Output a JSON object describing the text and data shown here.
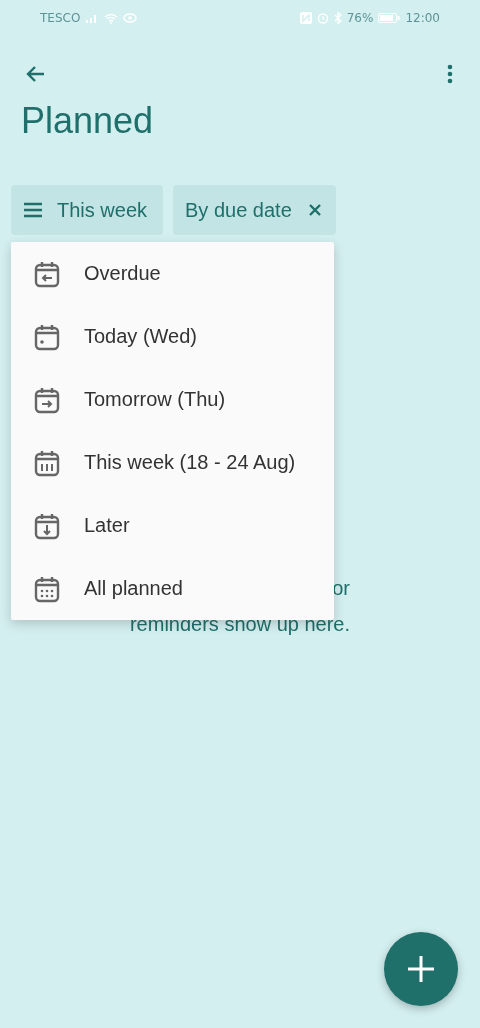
{
  "status_bar": {
    "carrier": "TESCO",
    "battery": "76%",
    "time": "12:00"
  },
  "title": "Planned",
  "chips": [
    {
      "label": "This week",
      "kind": "menu"
    },
    {
      "label": "By due date",
      "kind": "removable"
    }
  ],
  "menu": [
    {
      "label": "Overdue"
    },
    {
      "label": "Today (Wed)"
    },
    {
      "label": "Tomorrow (Thu)"
    },
    {
      "label": "This week (18 - 24 Aug)"
    },
    {
      "label": "Later"
    },
    {
      "label": "All planned"
    }
  ],
  "empty_message": [
    "or",
    "reminders show up here."
  ]
}
